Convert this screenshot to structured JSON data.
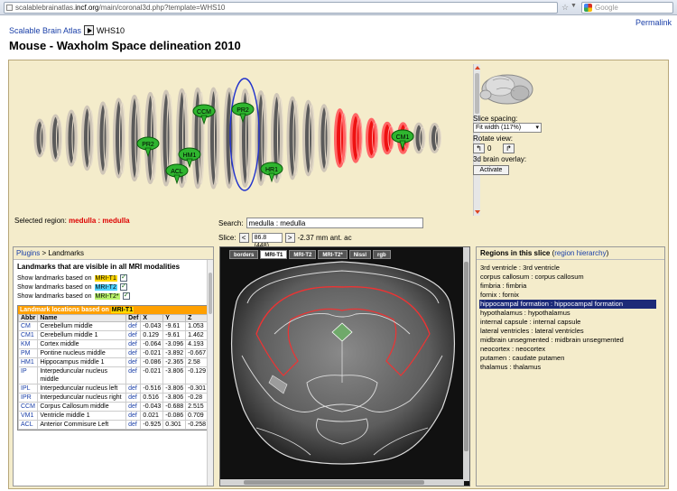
{
  "browser": {
    "url_prefix": "scalablebrainatlas.",
    "url_domain": "incf.org",
    "url_suffix": "/main/coronal3d.php?template=WHS10",
    "search_engine": "Google"
  },
  "header": {
    "permalink": "Permalink",
    "breadcrumb_link": "Scalable Brain Atlas",
    "breadcrumb_current": "WHS10",
    "title": "Mouse - Waxholm Space delineation 2010"
  },
  "overview": {
    "landmarks": [
      "CCM",
      "CM1",
      "CM1",
      "PR2",
      "HM1",
      "ACL",
      "HR1",
      "PR2"
    ],
    "selected_label": "Selected region:",
    "selected_value": "medulla : medulla"
  },
  "controls": {
    "slice_spacing_label": "Slice spacing:",
    "slice_spacing_value": "Fit width (117%)",
    "rotate_label": "Rotate view:",
    "rotate_left": "↰",
    "rotate_value": "0",
    "rotate_right": "↱",
    "overlay_label": "3d brain overlay:",
    "activate_label": "Activate"
  },
  "search": {
    "label": "Search:",
    "value": "medulla : medulla"
  },
  "slice": {
    "label": "Slice:",
    "prev": "<",
    "value": "86.8 (448)",
    "next": ">",
    "position": "-2.37 mm ant. ac"
  },
  "landmarks_panel": {
    "breadcrumb_link": "Plugins",
    "breadcrumb_sep": " > ",
    "breadcrumb_current": "Landmarks",
    "heading": "Landmarks that are visible in all MRI modalities",
    "options": [
      {
        "prefix": "Show landmarks based on",
        "modality": "MRI-T1",
        "color": "#ffd800"
      },
      {
        "prefix": "Show landmarks based on",
        "modality": "MRI-T2",
        "color": "#4fd3ff"
      },
      {
        "prefix": "Show landmarks based on",
        "modality": "MRI-T2*",
        "color": "#b8f26a"
      }
    ],
    "table_caption": "Landmark locations based on",
    "table_modality": "MRI-T1",
    "columns": [
      "Abbr",
      "Name",
      "Def",
      "X",
      "Y",
      "Z"
    ],
    "rows": [
      [
        "CM",
        "Cerebellum middle",
        "def",
        "-0.043",
        "-9.61",
        "1.053"
      ],
      [
        "CM1",
        "Cerebellum middle 1",
        "def",
        "0.129",
        "-9.61",
        "1.462"
      ],
      [
        "KM",
        "Cortex middle",
        "def",
        "-0.064",
        "-3.096",
        "4.193"
      ],
      [
        "PM",
        "Pontine nucleus middle",
        "def",
        "-0.021",
        "-3.892",
        "-0.667"
      ],
      [
        "HM1",
        "Hippocampus middle 1",
        "def",
        "-0.086",
        "-2.365",
        "2.58"
      ],
      [
        "IP",
        "Interpeduncular nucleus middle",
        "def",
        "-0.021",
        "-3.806",
        "-0.129"
      ],
      [
        "IPL",
        "Interpeduncular nucleus left",
        "def",
        "-0.516",
        "-3.806",
        "-0.301"
      ],
      [
        "IPR",
        "Interpeduncular nucleus right",
        "def",
        "0.516",
        "-3.806",
        "-0.28"
      ],
      [
        "CCM",
        "Corpus Callosum middle",
        "def",
        "-0.043",
        "-0.688",
        "2.515"
      ],
      [
        "VM1",
        "Ventricle middle 1",
        "def",
        "0.021",
        "-0.086",
        "0.709"
      ],
      [
        "ACL",
        "Anterior Commisure Left",
        "def",
        "-0.925",
        "0.301",
        "-0.258"
      ]
    ]
  },
  "viewer": {
    "tabs": [
      "borders",
      "MRI-T1",
      "MRI-T2",
      "MRI-T2*",
      "Nissl",
      "rgb"
    ],
    "active_tab": "MRI-T1"
  },
  "regions_panel": {
    "title": "Regions in this slice",
    "hierarchy_link": "region hierarchy",
    "items": [
      "3rd ventricle : 3rd ventricle",
      "corpus callosum : corpus callosum",
      "fimbria : fimbria",
      "fornix : fornix",
      "hippocampal formation : hippocampal formation",
      "hypothalamus : hypothalamus",
      "internal capsule : internal capsule",
      "lateral ventricles : lateral ventricles",
      "midbrain unsegmented : midbrain unsegmented",
      "neocortex : neocortex",
      "putamen : caudate putamen",
      "thalamus : thalamus"
    ],
    "selected_index": 4,
    "selected_color": "#1c2a78"
  }
}
